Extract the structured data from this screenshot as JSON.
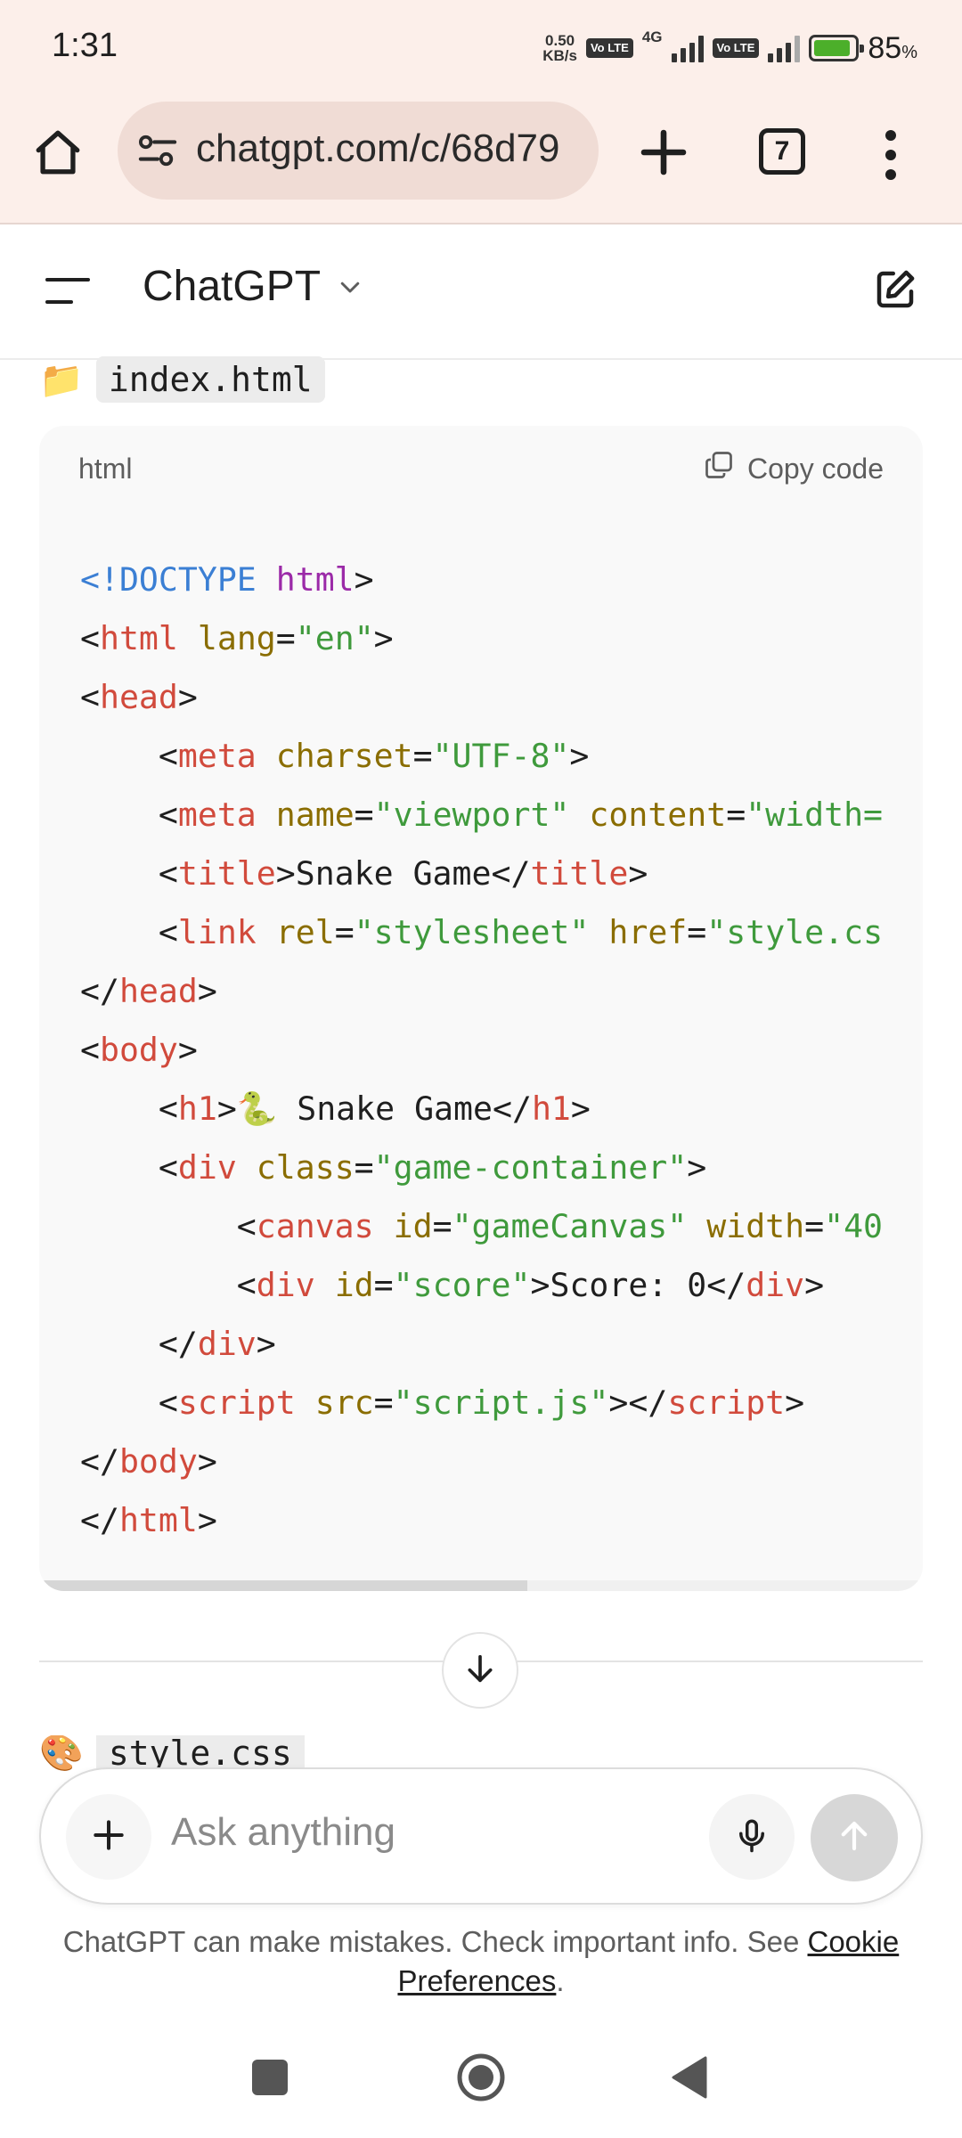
{
  "status_bar": {
    "time": "1:31",
    "net_speed_value": "0.50",
    "net_speed_unit": "KB/s",
    "volte1": "Vo LTE",
    "network_type": "4G",
    "volte2": "Vo LTE",
    "battery_percent": "85",
    "battery_unit": "%"
  },
  "browser": {
    "url": "chatgpt.com/c/68d79",
    "tab_count": "7"
  },
  "header": {
    "title": "ChatGPT"
  },
  "message": {
    "file1_emoji": "📁",
    "file1_name": "index.html",
    "code_lang": "html",
    "copy_label": "Copy code",
    "file2_emoji": "🎨",
    "file2_name": "style.css"
  },
  "code_lines": [
    [
      {
        "t": "<!DOCTYPE ",
        "c": "#3b7fd4"
      },
      {
        "t": "html",
        "c": "#9b2aa8"
      },
      {
        "t": ">",
        "c": "#1f1f1f"
      }
    ],
    [
      {
        "t": "<",
        "c": "#1f1f1f"
      },
      {
        "t": "html",
        "c": "#d14a3c"
      },
      {
        "t": " ",
        "c": "#1f1f1f"
      },
      {
        "t": "lang",
        "c": "#8a6d00"
      },
      {
        "t": "=",
        "c": "#1f1f1f"
      },
      {
        "t": "\"en\"",
        "c": "#3f9a3c"
      },
      {
        "t": ">",
        "c": "#1f1f1f"
      }
    ],
    [
      {
        "t": "<",
        "c": "#1f1f1f"
      },
      {
        "t": "head",
        "c": "#d14a3c"
      },
      {
        "t": ">",
        "c": "#1f1f1f"
      }
    ],
    [
      {
        "t": "    <",
        "c": "#1f1f1f"
      },
      {
        "t": "meta",
        "c": "#d14a3c"
      },
      {
        "t": " ",
        "c": "#1f1f1f"
      },
      {
        "t": "charset",
        "c": "#8a6d00"
      },
      {
        "t": "=",
        "c": "#1f1f1f"
      },
      {
        "t": "\"UTF-8\"",
        "c": "#3f9a3c"
      },
      {
        "t": ">",
        "c": "#1f1f1f"
      }
    ],
    [
      {
        "t": "    <",
        "c": "#1f1f1f"
      },
      {
        "t": "meta",
        "c": "#d14a3c"
      },
      {
        "t": " ",
        "c": "#1f1f1f"
      },
      {
        "t": "name",
        "c": "#8a6d00"
      },
      {
        "t": "=",
        "c": "#1f1f1f"
      },
      {
        "t": "\"viewport\"",
        "c": "#3f9a3c"
      },
      {
        "t": " ",
        "c": "#1f1f1f"
      },
      {
        "t": "content",
        "c": "#8a6d00"
      },
      {
        "t": "=",
        "c": "#1f1f1f"
      },
      {
        "t": "\"width=",
        "c": "#3f9a3c"
      }
    ],
    [
      {
        "t": "    <",
        "c": "#1f1f1f"
      },
      {
        "t": "title",
        "c": "#d14a3c"
      },
      {
        "t": ">Snake Game</",
        "c": "#1f1f1f"
      },
      {
        "t": "title",
        "c": "#d14a3c"
      },
      {
        "t": ">",
        "c": "#1f1f1f"
      }
    ],
    [
      {
        "t": "    <",
        "c": "#1f1f1f"
      },
      {
        "t": "link",
        "c": "#d14a3c"
      },
      {
        "t": " ",
        "c": "#1f1f1f"
      },
      {
        "t": "rel",
        "c": "#8a6d00"
      },
      {
        "t": "=",
        "c": "#1f1f1f"
      },
      {
        "t": "\"stylesheet\"",
        "c": "#3f9a3c"
      },
      {
        "t": " ",
        "c": "#1f1f1f"
      },
      {
        "t": "href",
        "c": "#8a6d00"
      },
      {
        "t": "=",
        "c": "#1f1f1f"
      },
      {
        "t": "\"style.cs",
        "c": "#3f9a3c"
      }
    ],
    [
      {
        "t": "</",
        "c": "#1f1f1f"
      },
      {
        "t": "head",
        "c": "#d14a3c"
      },
      {
        "t": ">",
        "c": "#1f1f1f"
      }
    ],
    [
      {
        "t": "<",
        "c": "#1f1f1f"
      },
      {
        "t": "body",
        "c": "#d14a3c"
      },
      {
        "t": ">",
        "c": "#1f1f1f"
      }
    ],
    [
      {
        "t": "    <",
        "c": "#1f1f1f"
      },
      {
        "t": "h1",
        "c": "#d14a3c"
      },
      {
        "t": ">🐍 Snake Game</",
        "c": "#1f1f1f"
      },
      {
        "t": "h1",
        "c": "#d14a3c"
      },
      {
        "t": ">",
        "c": "#1f1f1f"
      }
    ],
    [
      {
        "t": "    <",
        "c": "#1f1f1f"
      },
      {
        "t": "div",
        "c": "#d14a3c"
      },
      {
        "t": " ",
        "c": "#1f1f1f"
      },
      {
        "t": "class",
        "c": "#8a6d00"
      },
      {
        "t": "=",
        "c": "#1f1f1f"
      },
      {
        "t": "\"game-container\"",
        "c": "#3f9a3c"
      },
      {
        "t": ">",
        "c": "#1f1f1f"
      }
    ],
    [
      {
        "t": "        <",
        "c": "#1f1f1f"
      },
      {
        "t": "canvas",
        "c": "#d14a3c"
      },
      {
        "t": " ",
        "c": "#1f1f1f"
      },
      {
        "t": "id",
        "c": "#8a6d00"
      },
      {
        "t": "=",
        "c": "#1f1f1f"
      },
      {
        "t": "\"gameCanvas\"",
        "c": "#3f9a3c"
      },
      {
        "t": " ",
        "c": "#1f1f1f"
      },
      {
        "t": "width",
        "c": "#8a6d00"
      },
      {
        "t": "=",
        "c": "#1f1f1f"
      },
      {
        "t": "\"40",
        "c": "#3f9a3c"
      }
    ],
    [
      {
        "t": "        <",
        "c": "#1f1f1f"
      },
      {
        "t": "div",
        "c": "#d14a3c"
      },
      {
        "t": " ",
        "c": "#1f1f1f"
      },
      {
        "t": "id",
        "c": "#8a6d00"
      },
      {
        "t": "=",
        "c": "#1f1f1f"
      },
      {
        "t": "\"score\"",
        "c": "#3f9a3c"
      },
      {
        "t": ">Score: 0</",
        "c": "#1f1f1f"
      },
      {
        "t": "div",
        "c": "#d14a3c"
      },
      {
        "t": ">",
        "c": "#1f1f1f"
      }
    ],
    [
      {
        "t": "    </",
        "c": "#1f1f1f"
      },
      {
        "t": "div",
        "c": "#d14a3c"
      },
      {
        "t": ">",
        "c": "#1f1f1f"
      }
    ],
    [
      {
        "t": "    <",
        "c": "#1f1f1f"
      },
      {
        "t": "script",
        "c": "#d14a3c"
      },
      {
        "t": " ",
        "c": "#1f1f1f"
      },
      {
        "t": "src",
        "c": "#8a6d00"
      },
      {
        "t": "=",
        "c": "#1f1f1f"
      },
      {
        "t": "\"script.js\"",
        "c": "#3f9a3c"
      },
      {
        "t": "></",
        "c": "#1f1f1f"
      },
      {
        "t": "script",
        "c": "#d14a3c"
      },
      {
        "t": ">",
        "c": "#1f1f1f"
      }
    ],
    [
      {
        "t": "</",
        "c": "#1f1f1f"
      },
      {
        "t": "body",
        "c": "#d14a3c"
      },
      {
        "t": ">",
        "c": "#1f1f1f"
      }
    ],
    [
      {
        "t": "</",
        "c": "#1f1f1f"
      },
      {
        "t": "html",
        "c": "#d14a3c"
      },
      {
        "t": ">",
        "c": "#1f1f1f"
      }
    ]
  ],
  "composer": {
    "placeholder": "Ask anything"
  },
  "footer": {
    "disclaimer": "ChatGPT can make mistakes. Check important info. See ",
    "link": "Cookie Preferences",
    "end": "."
  },
  "colors": {
    "chrome_bg": "#fcefea",
    "url_pill": "#f0dcd5",
    "code_bg": "#f9f9f9",
    "send_disabled": "#d7d7d7"
  },
  "icons": [
    "home-icon",
    "site-settings-icon",
    "plus-icon",
    "tabs-icon",
    "more-vert-icon",
    "sidebar-menu-icon",
    "chevron-down-icon",
    "new-chat-icon",
    "copy-icon",
    "arrow-down-icon",
    "mic-icon",
    "arrow-up-icon"
  ]
}
